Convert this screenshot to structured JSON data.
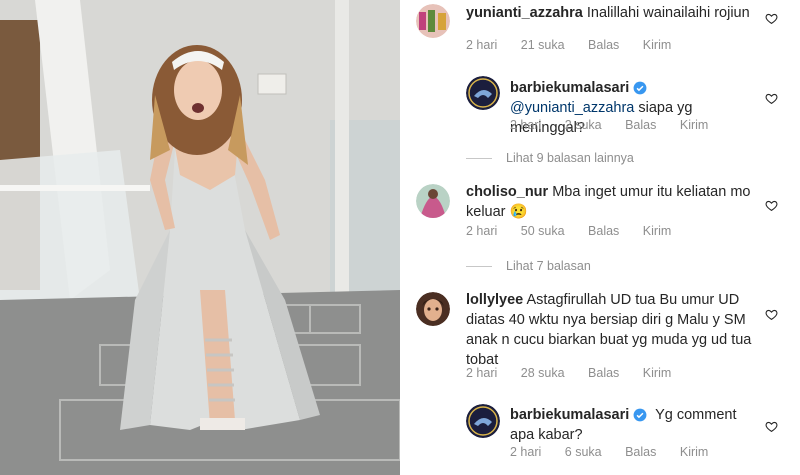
{
  "comments": [
    {
      "username": "yunianti_azzahra",
      "text": "Inalillahi wainailaihi rojiun",
      "time": "2 hari",
      "likes": "21 suka",
      "reply": "Balas",
      "send": "Kirim"
    },
    {
      "username": "barbiekumalasari",
      "verified": true,
      "mention": "@yunianti_azzahra",
      "text": "siapa yg meninggal?",
      "time": "2 hari",
      "likes": "2 suka",
      "reply": "Balas",
      "send": "Kirim"
    },
    {
      "username": "choliso_nur",
      "text": "Mba inget umur itu keliatan mo keluar 😢",
      "time": "2 hari",
      "likes": "50 suka",
      "reply": "Balas",
      "send": "Kirim"
    },
    {
      "username": "lollylyee",
      "text": "Astagfirullah UD tua Bu umur UD diatas 40 wktu nya bersiap diri g Malu y SM anak n cucu biarkan buat yg muda yg ud tua tobat",
      "time": "2 hari",
      "likes": "28 suka",
      "reply": "Balas",
      "send": "Kirim"
    },
    {
      "username": "barbiekumalasari",
      "verified": true,
      "text": "Yg comment apa kabar?",
      "time": "2 hari",
      "likes": "6 suka",
      "reply": "Balas",
      "send": "Kirim"
    }
  ],
  "view_replies": [
    "Lihat 9 balasan lainnya",
    "Lihat 7 balasan"
  ],
  "icons": {
    "like": "heart-outline-icon",
    "verified": "verified-badge-icon"
  },
  "colors": {
    "verified": "#3897f0",
    "meta": "#8e8e8e",
    "mention": "#00376b"
  }
}
